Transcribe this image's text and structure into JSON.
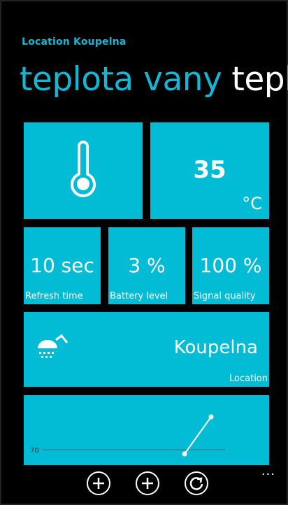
{
  "header": {
    "subtitle": "Location Koupelna",
    "pivot_active": "teplota vany",
    "pivot_next": "tepl"
  },
  "tiles": {
    "thermometer_icon": "thermometer-icon",
    "temperature": {
      "value": "35",
      "unit": "°C"
    },
    "refresh": {
      "value": "10 sec",
      "label": "Refresh time"
    },
    "battery": {
      "value": "3 %",
      "label": "Battery level"
    },
    "signal": {
      "value": "100 %",
      "label": "Signal quality"
    },
    "location": {
      "name": "Koupelna",
      "label": "Location",
      "icon": "shower-icon"
    }
  },
  "chart_data": {
    "type": "line",
    "ytick": "70",
    "series": [
      {
        "values": [
          70,
          75
        ]
      }
    ]
  },
  "appbar": {
    "buttons": [
      "add-icon",
      "add-icon",
      "refresh-icon"
    ],
    "more": "..."
  },
  "colors": {
    "accent": "#13b7d4",
    "tile": "#01bcd4",
    "background": "#000000"
  }
}
